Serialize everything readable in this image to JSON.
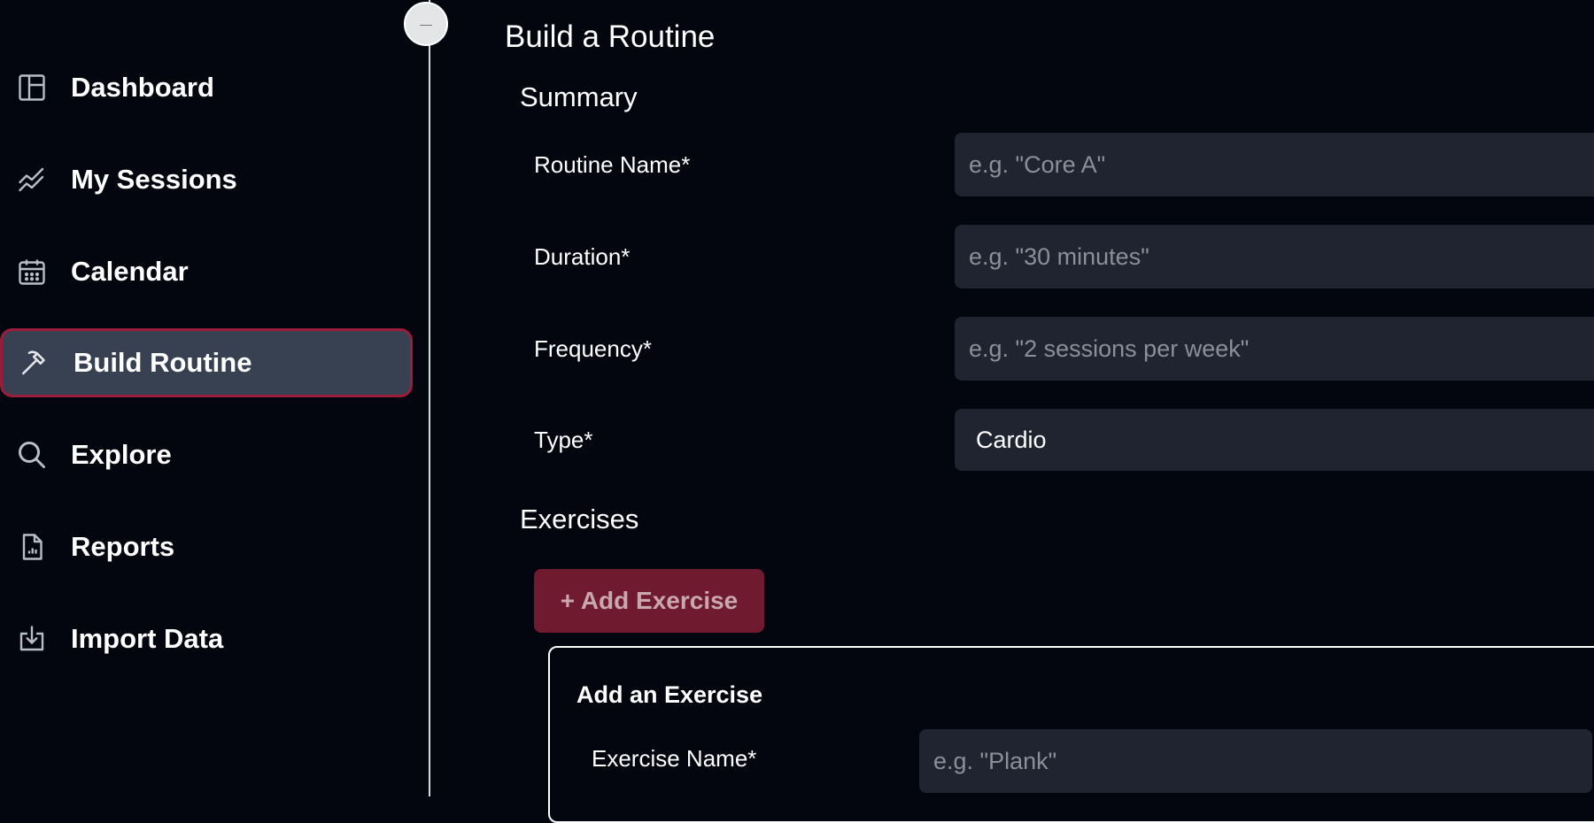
{
  "sidebar": {
    "collapse_glyph": "—",
    "items": [
      {
        "label": "Dashboard",
        "icon": "dashboard-icon"
      },
      {
        "label": "My Sessions",
        "icon": "trend-chart-icon"
      },
      {
        "label": "Calendar",
        "icon": "calendar-icon"
      },
      {
        "label": "Build Routine",
        "icon": "hammer-icon",
        "active": true
      },
      {
        "label": "Explore",
        "icon": "search-icon"
      },
      {
        "label": "Reports",
        "icon": "report-file-icon"
      },
      {
        "label": "Import Data",
        "icon": "import-icon"
      }
    ]
  },
  "main": {
    "title": "Build a Routine",
    "summary": {
      "heading": "Summary",
      "routine_name": {
        "label": "Routine Name*",
        "placeholder": "e.g. \"Core A\"",
        "value": ""
      },
      "duration": {
        "label": "Duration*",
        "placeholder": "e.g. \"30 minutes\"",
        "value": ""
      },
      "frequency": {
        "label": "Frequency*",
        "placeholder": "e.g. \"2 sessions per week\"",
        "value": ""
      },
      "type": {
        "label": "Type*",
        "selected": "Cardio"
      }
    },
    "exercises": {
      "heading": "Exercises",
      "add_button": "+ Add Exercise",
      "card": {
        "title": "Add an Exercise",
        "exercise_name": {
          "label": "Exercise Name*",
          "placeholder": "e.g. \"Plank\"",
          "value": ""
        }
      }
    }
  },
  "colors": {
    "background": "#03060f",
    "active_nav_bg": "#374151",
    "active_nav_border": "#9c1d3a",
    "input_bg": "#1f2430",
    "add_button_bg": "#6f1a2f",
    "add_button_text": "#c9a7ae"
  }
}
